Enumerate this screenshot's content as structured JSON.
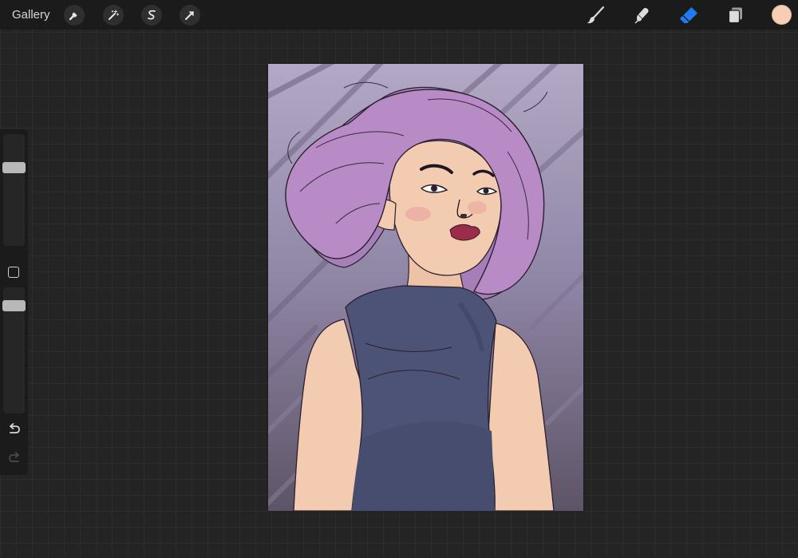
{
  "app": {
    "gallery_label": "Gallery"
  },
  "toolbar": {
    "left_tools": [
      "wrench-icon",
      "magic-wand-icon",
      "selection-icon",
      "transform-arrow-icon"
    ],
    "right_tools": [
      "brush-icon",
      "smudge-icon",
      "eraser-icon",
      "layers-icon"
    ],
    "active_tool": "eraser-icon",
    "active_color": "#f7cdb3",
    "accent_color": "#1e7cf0"
  },
  "sidebar": {
    "brush_size_level": 0.72,
    "opacity_level": 0.75,
    "modify_icon": "square-icon",
    "undo_icon": "undo-icon",
    "redo_icon": "redo-icon",
    "redo_enabled": false
  },
  "canvas": {
    "artwork": "illustration-woman-purple-hair",
    "colors": {
      "bg_top": "#b2a8c6",
      "bg_bottom": "#5f5568",
      "hair": "#b88bc6",
      "skin": "#f3cbb0",
      "top": "#4c5376",
      "lips": "#9b2d4a"
    }
  }
}
